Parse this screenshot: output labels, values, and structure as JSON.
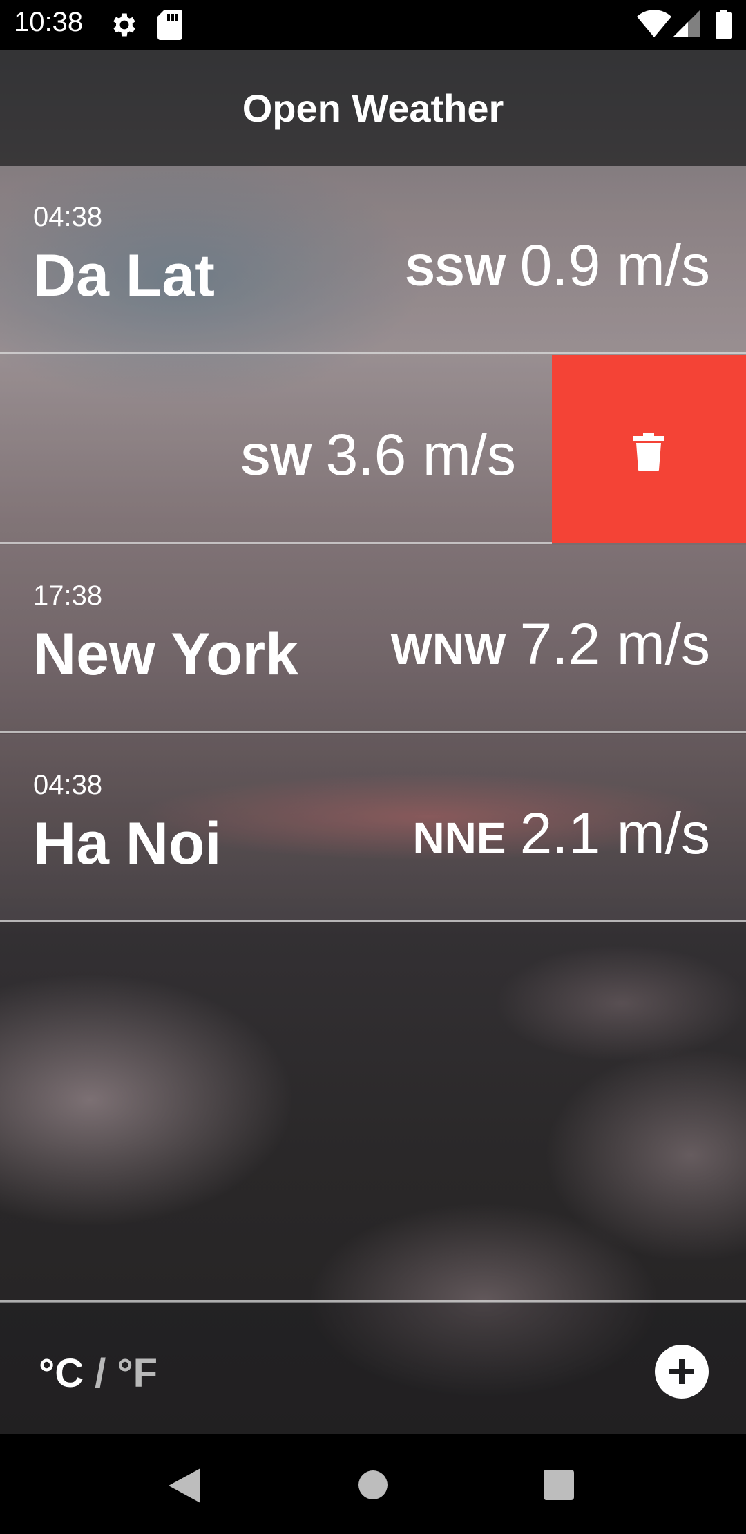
{
  "status_bar": {
    "time": "10:38"
  },
  "app": {
    "title": "Open Weather"
  },
  "cities": [
    {
      "time": "04:38",
      "name": "Da Lat",
      "direction": "SSW",
      "speed": "0.9 m/s"
    },
    {
      "time": "",
      "name": "",
      "direction": "SW",
      "speed": "3.6 m/s"
    },
    {
      "time": "17:38",
      "name": "New York",
      "direction": "WNW",
      "speed": "7.2 m/s"
    },
    {
      "time": "04:38",
      "name": "Ha Noi",
      "direction": "NNE",
      "speed": "2.1 m/s"
    }
  ],
  "units": {
    "celsius": "°C",
    "separator": "/",
    "fahrenheit": "°F"
  },
  "colors": {
    "delete": "#f44336",
    "header": "#1e1e20"
  },
  "icons": {
    "delete": "trash-icon",
    "add": "add-circle-icon",
    "settings": "gear-icon",
    "sd_card": "sd-card-icon",
    "wifi": "wifi-icon",
    "signal": "signal-icon",
    "battery": "battery-icon",
    "back": "back-icon",
    "home": "home-icon",
    "recents": "recents-icon"
  }
}
